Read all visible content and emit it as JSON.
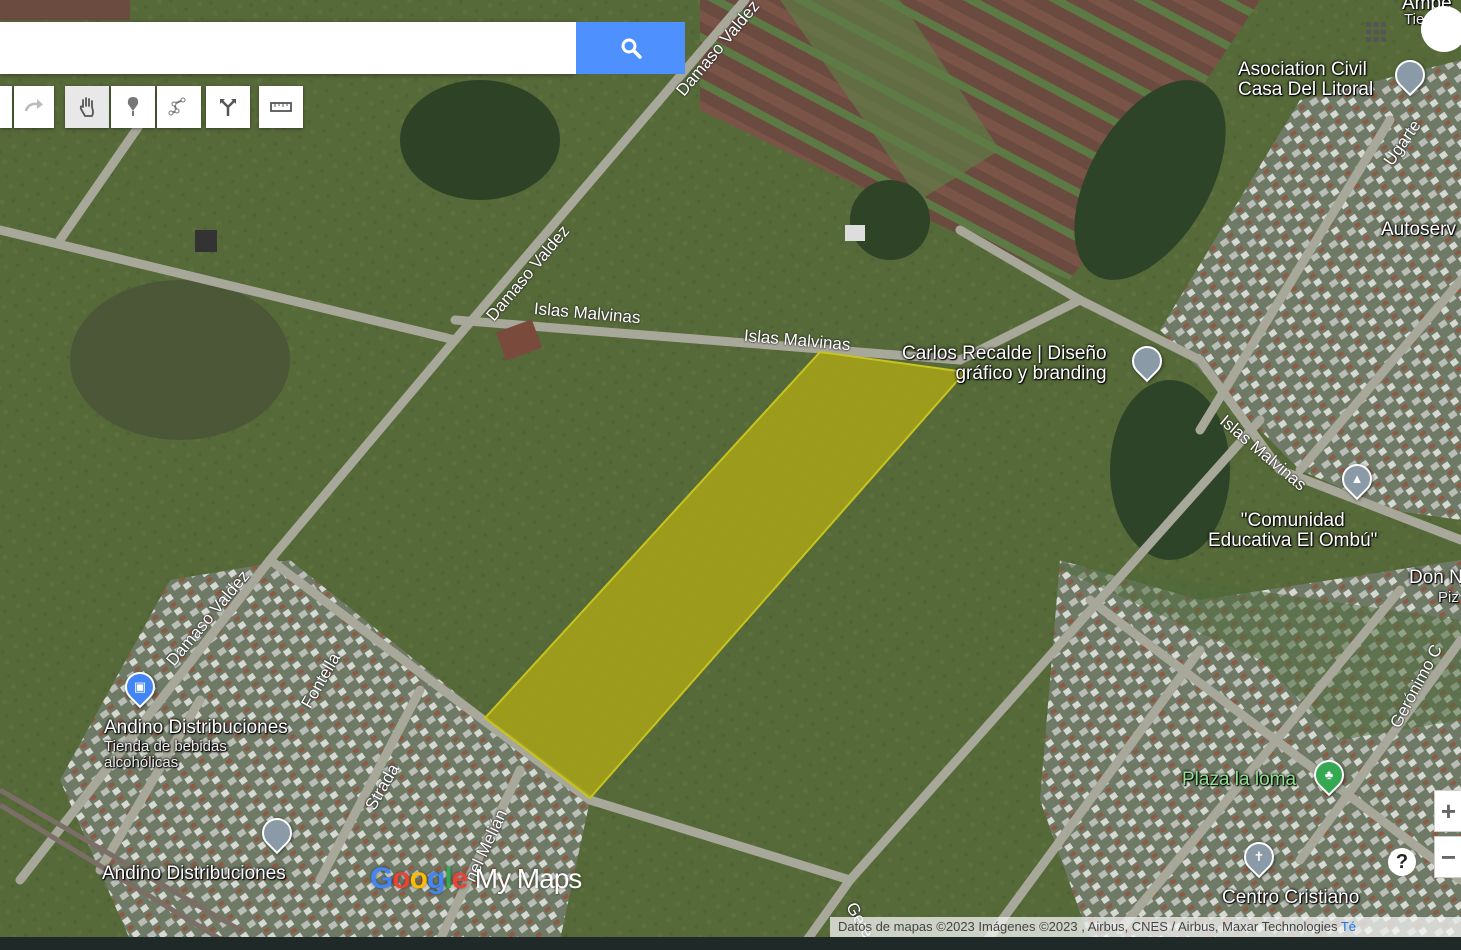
{
  "search": {
    "value": "",
    "placeholder": ""
  },
  "roads": {
    "damaso1": "Damaso Valdez",
    "damaso2": "Damaso Valdez",
    "damaso3": "Damaso Valdez",
    "malvinas1": "Islas Malvinas",
    "malvinas2": "Islas Malvinas",
    "malvinas3": "Islas Malvinas",
    "ugarte": "Ugarte",
    "fontella": "Fontella",
    "strada": "Strada",
    "melian": "nel Melián",
    "geronimo": "Gerónimo C",
    "gere": "Gere"
  },
  "places": {
    "asociacion": "Asociation Civil\nCasa Del Litoral",
    "carlos": "Carlos Recalde | Diseño\ngráfico y branding",
    "comunidad": "\"Comunidad\nEducativa El Ombú\"",
    "andino1": "Andino Distribuciones",
    "andino1_sub": "Tienda de bebidas\nalcohólicas",
    "andino2": "Andino Distribuciones",
    "plaza": "Plaza la loma",
    "centro": "Centro Cristiano",
    "autoserv": "Autoserv",
    "don": "Don N",
    "piz": "Piz",
    "top_right": "Ambe",
    "top_right_sub": "Tie"
  },
  "logo": {
    "google": "Google",
    "mymaps": "My Maps"
  },
  "attribution": {
    "text": "Datos de mapas ©2023 Imágenes ©2023 , Airbus, CNES / Airbus, Maxar Technologies",
    "link": "Té"
  },
  "zoom": {
    "in": "+",
    "out": "−"
  },
  "help": "?",
  "colors": {
    "polygon_fill": "#a8a417",
    "polygon_stroke": "#c8c41f",
    "search_button": "#4d90fe",
    "pin_gray": "#8a9aa6",
    "pin_blue": "#4285f4",
    "pin_green": "#34a853"
  }
}
